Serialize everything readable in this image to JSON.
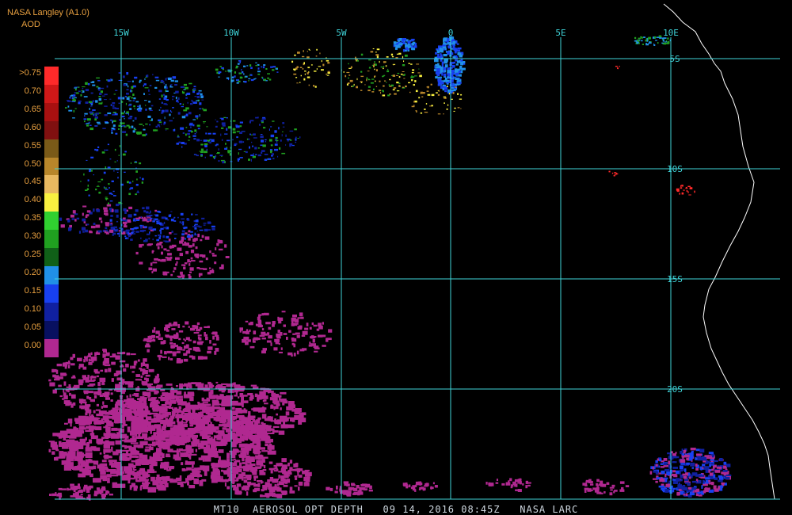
{
  "header": {
    "title": "NASA Langley (A1.0)",
    "subtitle": "AOD"
  },
  "legend": {
    "entries": [
      {
        "label": ">0.75",
        "color": "#ff2a2a"
      },
      {
        "label": "0.70",
        "color": "#d01818"
      },
      {
        "label": "0.65",
        "color": "#a81010"
      },
      {
        "label": "0.60",
        "color": "#801010"
      },
      {
        "label": "0.55",
        "color": "#7a5a18"
      },
      {
        "label": "0.50",
        "color": "#b8862a"
      },
      {
        "label": "0.45",
        "color": "#e8b860"
      },
      {
        "label": "0.40",
        "color": "#f8f040"
      },
      {
        "label": "0.35",
        "color": "#30d030"
      },
      {
        "label": "0.30",
        "color": "#20a020"
      },
      {
        "label": "0.25",
        "color": "#106018"
      },
      {
        "label": "0.20",
        "color": "#2090e8"
      },
      {
        "label": "0.15",
        "color": "#1840f0"
      },
      {
        "label": "0.10",
        "color": "#1020a0"
      },
      {
        "label": "0.05",
        "color": "#081060"
      },
      {
        "label": "0.00",
        "color": "#b02890"
      }
    ]
  },
  "map": {
    "lon_labels": [
      "15W",
      "10W",
      "5W",
      "0",
      "5E",
      "10E"
    ],
    "lat_labels": [
      "5S",
      "10S",
      "15S",
      "20S"
    ],
    "gridline_color": "#3fd3d8",
    "coastline_color": "#ffffff"
  },
  "footer": {
    "text": "MT10  AEROSOL OPT DEPTH   09 14, 2016 08:45Z   NASA LARC"
  }
}
